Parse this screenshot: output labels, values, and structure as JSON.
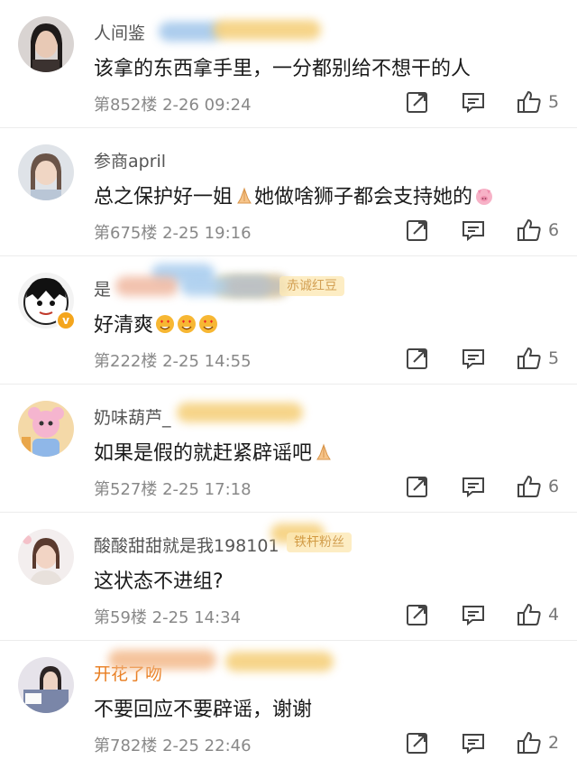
{
  "comments": [
    {
      "username": "人间鉴",
      "text": "该拿的东西拿手里，一分都别给不想干的人",
      "floor": "第852楼",
      "time": "2-26 09:24",
      "likes": "5"
    },
    {
      "username": "参商april",
      "text": "总之保护好一姐",
      "text_after": "她做啥狮子都会支持她的",
      "floor": "第675楼",
      "time": "2-25 19:16",
      "likes": "6"
    },
    {
      "username": "是",
      "badge": "赤诚红豆",
      "text": "好清爽",
      "floor": "第222楼",
      "time": "2-25 14:55",
      "likes": "5"
    },
    {
      "username": "奶味葫芦_",
      "text": "如果是假的就赶紧辟谣吧",
      "floor": "第527楼",
      "time": "2-25 17:18",
      "likes": "6"
    },
    {
      "username": "酸酸甜甜就是我198101",
      "badge": "铁杆粉丝",
      "text": "这状态不进组?",
      "floor": "第59楼",
      "time": "2-25 14:34",
      "likes": "4"
    },
    {
      "username": "开花了吻",
      "text": "不要回应不要辟谣，谢谢",
      "floor": "第782楼",
      "time": "2-25 22:46",
      "likes": "2"
    }
  ],
  "icons": {
    "share": "share-icon",
    "reply": "comment-icon",
    "like": "thumbs-up-icon"
  },
  "colors": {
    "username": "#555555",
    "username_highlight": "#e87b1c",
    "body": "#1a1a1a",
    "meta": "#888888",
    "badge_bg": "#fde9b6"
  }
}
